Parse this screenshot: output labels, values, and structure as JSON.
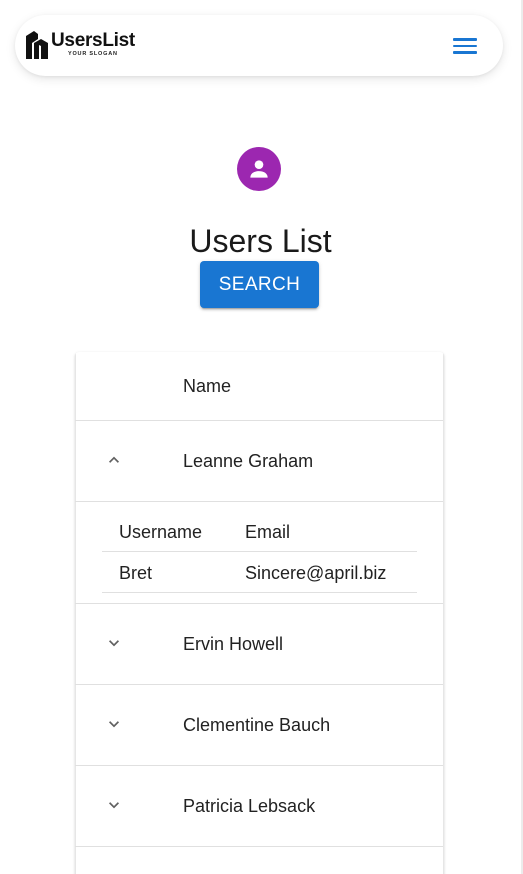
{
  "header": {
    "logo_title": "UsersList",
    "logo_slogan": "YOUR SLOGAN",
    "menu_icon": "hamburger-menu-icon",
    "accent_color": "#1976d2"
  },
  "hero": {
    "avatar_icon": "person-icon",
    "avatar_color": "#9c27b0",
    "title": "Users List",
    "search_label": "SEARCH"
  },
  "table": {
    "header_name": "Name",
    "rows": [
      {
        "name": "Leanne Graham",
        "expanded": true,
        "details": {
          "username_header": "Username",
          "email_header": "Email",
          "username": "Bret",
          "email": "Sincere@april.biz"
        }
      },
      {
        "name": "Ervin Howell",
        "expanded": false
      },
      {
        "name": "Clementine Bauch",
        "expanded": false
      },
      {
        "name": "Patricia Lebsack",
        "expanded": false
      },
      {
        "name": "",
        "expanded": false
      }
    ]
  }
}
